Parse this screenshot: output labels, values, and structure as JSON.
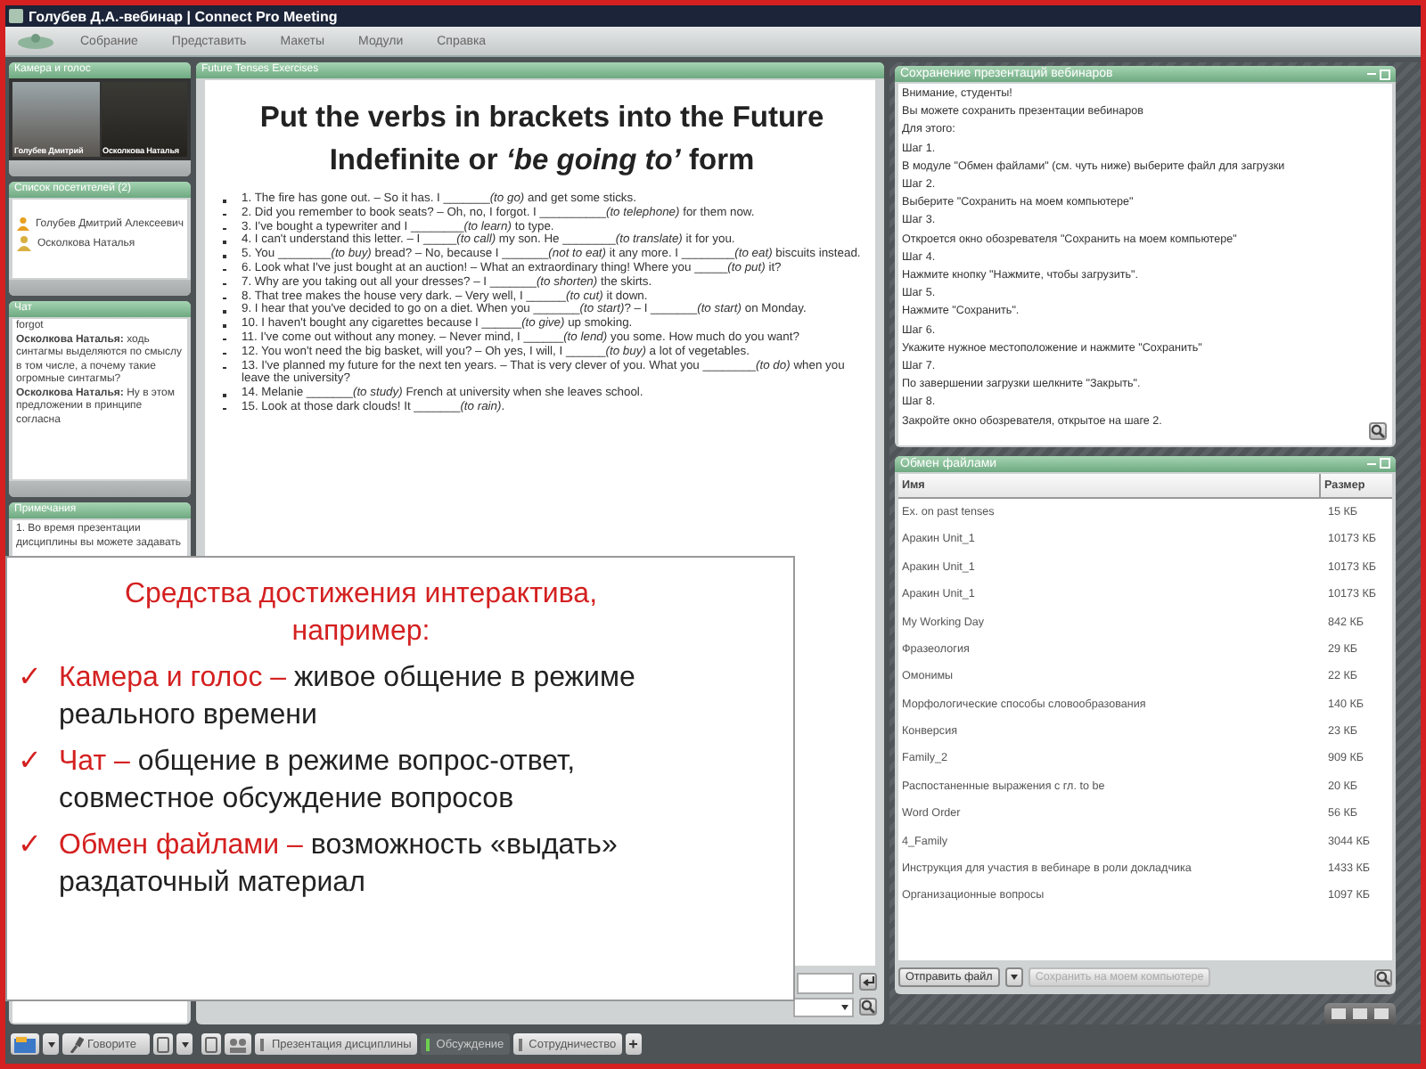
{
  "window": {
    "title": "Голубев Д.А.-вебинар | Connect Pro Meeting"
  },
  "menu": [
    "Собрание",
    "Представить",
    "Макеты",
    "Модули",
    "Справка"
  ],
  "camera_pod": {
    "title": "Камера и голос",
    "videos": [
      {
        "name": "Голубев Дмитрий"
      },
      {
        "name": "Осколкова Наталья"
      }
    ]
  },
  "attendees_pod": {
    "title": "Список посетителей (2)",
    "attendees": [
      {
        "name": "Голубев Дмитрий Алексеевич",
        "kind": "host"
      },
      {
        "name": "Осколкова Наталья",
        "kind": "participant"
      }
    ]
  },
  "chat_pod": {
    "title": "Чат",
    "messages": [
      "forgot",
      "**Осколкова Наталья:** ходь синтагмы выделяются по смыслу в том числе, а почему такие огромные синтагмы?",
      "**Осколкова Наталья:** Ну в этом предложении в принципе согласна"
    ]
  },
  "notes_pod": {
    "title": "Примечания",
    "text": "1. Во время презентации дисциплины вы можете задавать"
  },
  "presentation_pod": {
    "title": "Future Tenses Exercises",
    "heading": [
      [
        {
          "text": "Put the verbs in brackets into the Future"
        }
      ],
      [
        {
          "text": "Indefinite or "
        },
        {
          "text": "‘be going to’",
          "italic": true
        },
        {
          "text": " form"
        }
      ]
    ],
    "items": [
      [
        {
          "text": "1. The fire has gone out. – So it has. I _______"
        },
        {
          "text": "(to go)",
          "italic": true
        },
        {
          "text": " and get some sticks."
        }
      ],
      [
        {
          "text": "2. Did you remember to book seats? – Oh, no, I forgot. I __________"
        },
        {
          "text": "(to telephone)",
          "italic": true
        },
        {
          "text": " for them now."
        }
      ],
      [
        {
          "text": "3. I've bought a typewriter and I ________"
        },
        {
          "text": "(to learn)",
          "italic": true
        },
        {
          "text": " to type."
        }
      ],
      [
        {
          "text": "4. I can't understand this letter. – I _____"
        },
        {
          "text": "(to call)",
          "italic": true
        },
        {
          "text": " my son. He ________"
        },
        {
          "text": "(to translate)",
          "italic": true
        },
        {
          "text": " it for you."
        }
      ],
      [
        {
          "text": "5. You ________"
        },
        {
          "text": "(to buy)",
          "italic": true
        },
        {
          "text": " bread? – No, because I _______"
        },
        {
          "text": "(not to eat)",
          "italic": true
        },
        {
          "text": " it any more. I ________"
        },
        {
          "text": "(to eat)",
          "italic": true
        },
        {
          "text": " biscuits instead."
        }
      ],
      [
        {
          "text": "6. Look what I've just bought at an auction! – What an extraordinary thing! Where you _____"
        },
        {
          "text": "(to put)",
          "italic": true
        },
        {
          "text": " it?"
        }
      ],
      [
        {
          "text": "7. Why are you taking out all your dresses? – I _______"
        },
        {
          "text": "(to shorten)",
          "italic": true
        },
        {
          "text": " the skirts."
        }
      ],
      [
        {
          "text": "8. That tree makes the house very dark. – Very well, I ______"
        },
        {
          "text": "(to cut)",
          "italic": true
        },
        {
          "text": " it down."
        }
      ],
      [
        {
          "text": "9. I hear that you've decided to go on a diet. When you _______"
        },
        {
          "text": "(to start)",
          "italic": true
        },
        {
          "text": "? – I _______"
        },
        {
          "text": "(to start)",
          "italic": true
        },
        {
          "text": " on Monday."
        }
      ],
      [
        {
          "text": "10. I haven't bought any cigarettes because I ______"
        },
        {
          "text": "(to give)",
          "italic": true
        },
        {
          "text": " up smoking."
        }
      ],
      [
        {
          "text": "11. I've come out without any money. – Never mind, I ______"
        },
        {
          "text": "(to lend)",
          "italic": true
        },
        {
          "text": " you some. How much do you want?"
        }
      ],
      [
        {
          "text": "12. You won't need the big basket, will you? – Oh yes, I will, I ______"
        },
        {
          "text": "(to buy)",
          "italic": true
        },
        {
          "text": " a lot of vegetables."
        }
      ],
      [
        {
          "text": "13. I've planned my future for the next ten years. – That is very clever of you. What you ________"
        },
        {
          "text": "(to do)",
          "italic": true
        },
        {
          "text": " when you leave the university?"
        }
      ],
      [
        {
          "text": "14. Melanie _______"
        },
        {
          "text": "(to study)",
          "italic": true
        },
        {
          "text": " French at university when she leaves school."
        }
      ],
      [
        {
          "text": "15. Look at those dark clouds! It _______"
        },
        {
          "text": "(to rain)",
          "italic": true
        },
        {
          "text": "."
        }
      ]
    ]
  },
  "save_pod": {
    "title": "Сохранение презентаций вебинаров",
    "lines": [
      "Внимание, студенты!",
      "Вы можете сохранить презентации вебинаров",
      "Для этого:",
      "Шаг 1.",
      "В модуле \"Обмен файлами\" (см. чуть ниже) выберите файл для загрузки",
      "Шаг 2.",
      "Выберите \"Сохранить на моем компьютере\"",
      "Шаг 3.",
      "Откроется окно обозревателя \"Сохранить на моем компьютере\"",
      "Шаг 4.",
      "Нажмите кнопку \"Нажмите, чтобы загрузить\".",
      "Шаг 5.",
      "Нажмите \"Сохранить\".",
      "Шаг 6.",
      "Укажите нужное местоположение и нажмите \"Сохранить\"",
      "Шаг 7.",
      "По завершении загрузки шелкните \"Закрыть\".",
      "Шаг 8.",
      "Закройте окно обозревателя, открытое на шаге 2."
    ]
  },
  "files_pod": {
    "title": "Обмен файлами",
    "columns": [
      "Имя",
      "Размер"
    ],
    "rows": [
      {
        "name": "Ex. on past tenses",
        "size": "15 КБ"
      },
      {
        "name": "Аракин Unit_1",
        "size": "10173 КБ"
      },
      {
        "name": "Аракин Unit_1",
        "size": "10173 КБ"
      },
      {
        "name": "Аракин Unit_1",
        "size": "10173 КБ"
      },
      {
        "name": "My Working Day",
        "size": "842 КБ"
      },
      {
        "name": "Фразеология",
        "size": "29 КБ"
      },
      {
        "name": "Омонимы",
        "size": "22 КБ"
      },
      {
        "name": "Морфологические способы словообразования",
        "size": "140 КБ"
      },
      {
        "name": "Конверсия",
        "size": "23 КБ"
      },
      {
        "name": "Family_2",
        "size": "909 КБ"
      },
      {
        "name": "Распостаненные выражения с гл. to be",
        "size": "20 КБ"
      },
      {
        "name": "Word Order",
        "size": "56 КБ"
      },
      {
        "name": "4_Family",
        "size": "3044 КБ"
      },
      {
        "name": "Инструкция для участия в вебинаре в роли докладчика",
        "size": "1433 КБ"
      },
      {
        "name": "Организационные вопросы",
        "size": "1097 КБ"
      }
    ],
    "send_button": "Отправить файл",
    "save_button": {
      "label": "Сохранить на моем компьютере",
      "disabled": true
    }
  },
  "toolbar": {
    "talk_button": "Говорите",
    "tabs": [
      {
        "label": "Презентация дисциплины",
        "selected": false
      },
      {
        "label": "Обсуждение",
        "selected": true
      },
      {
        "label": "Сотрудничество",
        "selected": false
      }
    ],
    "add_button": "+"
  },
  "overlay": {
    "heading": "Средства достижения интерактива, например:",
    "bullets": [
      {
        "mark": "✓",
        "term": "Камера и голос –",
        "text": "живое общение в режиме реального времени"
      },
      {
        "mark": "✓",
        "term": "Чат –",
        "text": "общение в режиме вопрос-ответ, совместное обсуждение вопросов"
      },
      {
        "mark": "✓",
        "term": "Обмен файлами –",
        "text": "возможность «выдать» раздаточный материал"
      }
    ]
  }
}
